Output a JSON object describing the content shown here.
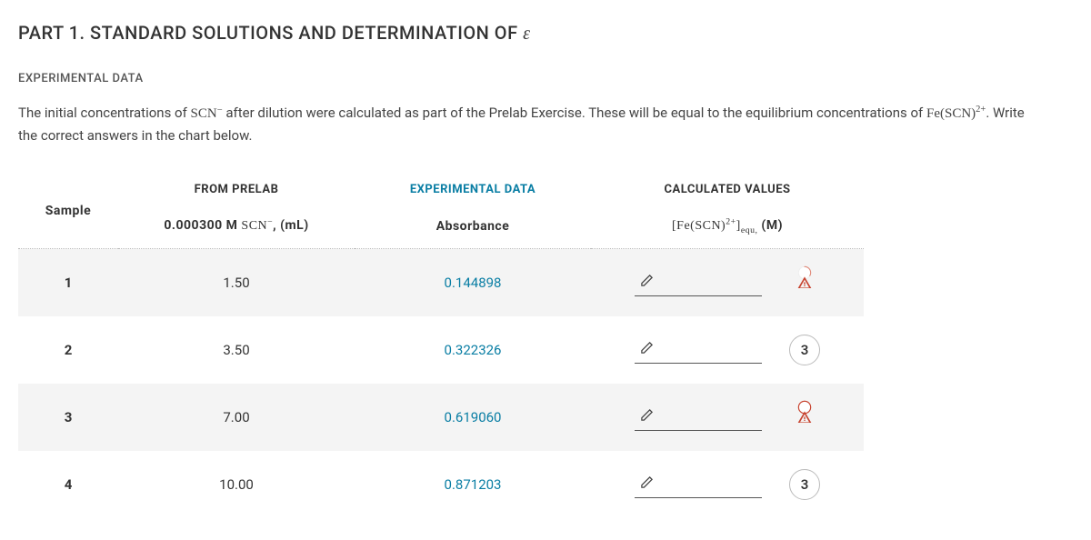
{
  "title_prefix": "PART 1. STANDARD SOLUTIONS AND DETERMINATION OF ",
  "title_symbol": "ε",
  "subheading": "EXPERIMENTAL DATA",
  "intro_1": "The initial concentrations of ",
  "intro_f1": "SCN",
  "intro_2": " after dilution were calculated as part of the Prelab Exercise. These will be equal to the equilibrium concentrations of ",
  "intro_f2": "Fe(SCN)",
  "intro_3": ". Write the correct answers in the chart below.",
  "headers": {
    "sample": "Sample",
    "from_prelab": "FROM PRELAB",
    "experimental_data": "EXPERIMENTAL DATA",
    "calculated_values": "CALCULATED VALUES",
    "col_prelab_prefix": "0.000300 M ",
    "col_prelab_formula": "SCN",
    "col_prelab_suffix": ", (mL)",
    "col_absorbance": "Absorbance",
    "col_calc_prefix": "[Fe(SCN)",
    "col_calc_sup": "2+",
    "col_calc_sub": "equ,",
    "col_calc_suffix": " (M)"
  },
  "rows": [
    {
      "sample": "1",
      "prelab": "1.50",
      "abs": "0.144898",
      "badge": {
        "type": "warn",
        "variant": "partial"
      }
    },
    {
      "sample": "2",
      "prelab": "3.50",
      "abs": "0.322326",
      "badge": {
        "type": "tries",
        "label": "3"
      }
    },
    {
      "sample": "3",
      "prelab": "7.00",
      "abs": "0.619060",
      "badge": {
        "type": "warn",
        "variant": "full"
      }
    },
    {
      "sample": "4",
      "prelab": "10.00",
      "abs": "0.871203",
      "badge": {
        "type": "tries",
        "label": "3"
      }
    }
  ]
}
